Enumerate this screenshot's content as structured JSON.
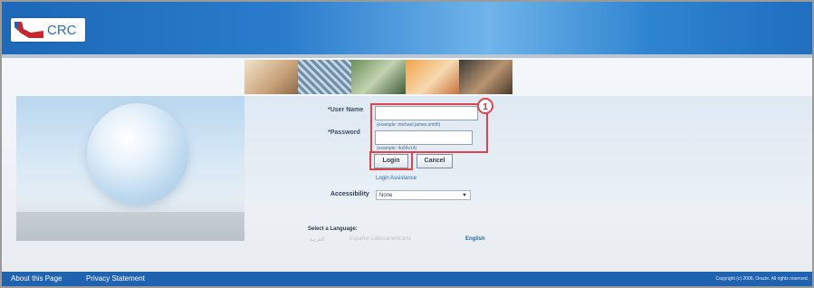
{
  "header": {
    "logo_text": "CRC"
  },
  "login_form": {
    "username_label": "*User Name",
    "username_value": "",
    "username_hint": "(example: michael.james.smith)",
    "password_label": "*Password",
    "password_value": "",
    "password_hint": "(example: 4u99v14)",
    "login_label": "Login",
    "cancel_label": "Cancel",
    "assistance_link": "Login Assistance",
    "callout_number": "1"
  },
  "accessibility": {
    "label": "Accessibility",
    "selected": "None"
  },
  "language": {
    "label": "Select a Language:",
    "options": [
      "العربية",
      "Español Latinoamericano",
      "English"
    ]
  },
  "footer": {
    "about_link": "About this Page",
    "privacy_link": "Privacy Statement",
    "copyright": "Copyright (c) 2006, Oracle. All rights reserved."
  },
  "colors": {
    "header_blue": "#2a7ccc",
    "footer_blue": "#1f63b0",
    "highlight_red": "#e0434b"
  }
}
